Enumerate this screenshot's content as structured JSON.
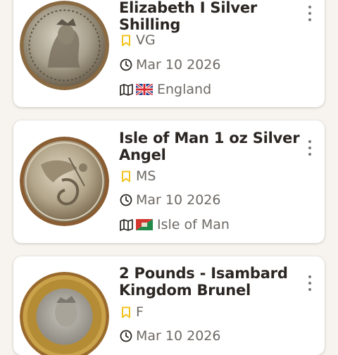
{
  "coins": [
    {
      "title_lines": [
        "Elizabeth I Silver",
        "Shilling"
      ],
      "grade": "VG",
      "date": "Mar 10 2026",
      "country": "England",
      "flag": "uk-flag"
    },
    {
      "title_lines": [
        "Isle of Man 1 oz Silver",
        "Angel"
      ],
      "grade": "MS",
      "date": "Mar 10 2026",
      "country": "Isle of Man",
      "flag": "isle-of-man-flag"
    },
    {
      "title_lines": [
        "2 Pounds - Isambard",
        "Kingdom Brunel"
      ],
      "grade": "F",
      "date": "Mar 10 2026",
      "country": "",
      "flag": ""
    }
  ],
  "icons": {
    "grade": "bookmark-icon",
    "date": "clock-icon",
    "country": "map-icon",
    "menu": "more-vertical-icon"
  },
  "colors": {
    "background": "#f7f3ee",
    "card": "#ffffff",
    "title": "#2b2622",
    "meta_text": "#6d6965",
    "grade_icon": "#f2c31b"
  }
}
